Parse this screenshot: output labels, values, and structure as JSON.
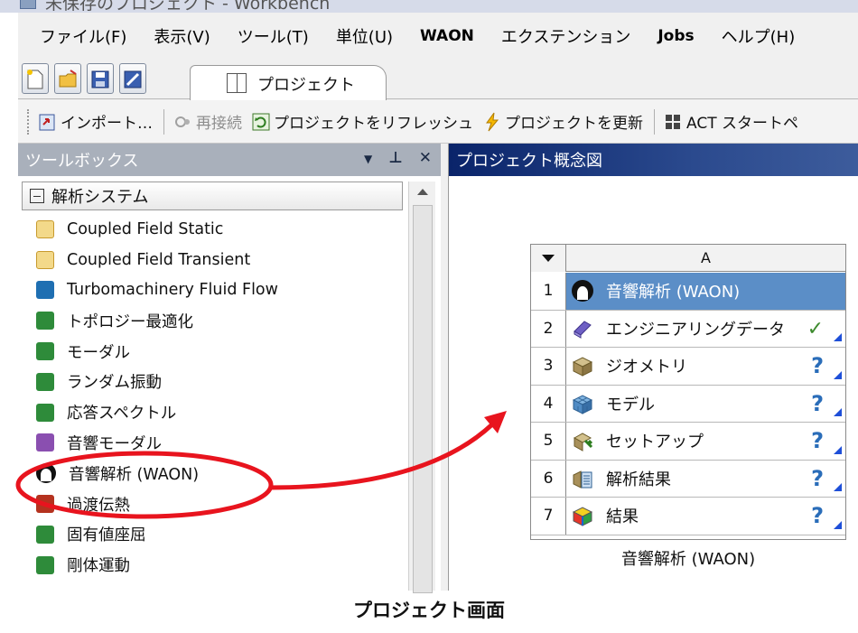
{
  "window": {
    "title": "未保存のプロジェクト - Workbench"
  },
  "menu": [
    "ファイル(F)",
    "表示(V)",
    "ツール(T)",
    "単位(U)",
    "WAON",
    "エクステンション",
    "Jobs",
    "ヘルプ(H)"
  ],
  "tab": {
    "label": "プロジェクト"
  },
  "toolbar": {
    "import": "インポート…",
    "reconnect": "再接続",
    "refresh": "プロジェクトをリフレッシュ",
    "update": "プロジェクトを更新",
    "act": "ACT スタートペ"
  },
  "toolbox": {
    "title": "ツールボックス",
    "category": "解析システム",
    "items": [
      {
        "label": "Coupled Field Static",
        "icon": "coupled-field-static-icon",
        "color": "#c79a2d"
      },
      {
        "label": "Coupled Field Transient",
        "icon": "coupled-field-transient-icon",
        "color": "#c79a2d"
      },
      {
        "label": "Turbomachinery Fluid Flow",
        "icon": "turbomachinery-icon",
        "color": "#1f6fb2"
      },
      {
        "label": "トポロジー最適化",
        "icon": "topology-icon",
        "color": "#2e8b3a"
      },
      {
        "label": "モーダル",
        "icon": "modal-icon",
        "color": "#2e8b3a"
      },
      {
        "label": "ランダム振動",
        "icon": "random-vibration-icon",
        "color": "#2e8b3a"
      },
      {
        "label": "応答スペクトル",
        "icon": "response-spectrum-icon",
        "color": "#2e8b3a"
      },
      {
        "label": "音響モーダル",
        "icon": "acoustic-modal-icon",
        "color": "#8a4fb0"
      },
      {
        "label": "音響解析 (WAON)",
        "icon": "waon-icon",
        "color": "#111111"
      },
      {
        "label": "過渡伝熱",
        "icon": "transient-thermal-icon",
        "color": "#b5321f"
      },
      {
        "label": "固有値座屈",
        "icon": "eigenvalue-buckling-icon",
        "color": "#2e8b3a"
      },
      {
        "label": "剛体運動",
        "icon": "rigid-dynamics-icon",
        "color": "#2e8b3a"
      }
    ]
  },
  "schematic": {
    "title": "プロジェクト概念図",
    "column": "A",
    "rows": [
      {
        "num": "1",
        "label": "音響解析 (WAON)",
        "icon": "waon-icon",
        "status": "",
        "selected": true
      },
      {
        "num": "2",
        "label": "エンジニアリングデータ",
        "icon": "engineering-data-icon",
        "status": "✓"
      },
      {
        "num": "3",
        "label": "ジオメトリ",
        "icon": "geometry-icon",
        "status": "?"
      },
      {
        "num": "4",
        "label": "モデル",
        "icon": "model-icon",
        "status": "?"
      },
      {
        "num": "5",
        "label": "セットアップ",
        "icon": "setup-icon",
        "status": "?"
      },
      {
        "num": "6",
        "label": "解析結果",
        "icon": "solution-icon",
        "status": "?"
      },
      {
        "num": "7",
        "label": "結果",
        "icon": "results-icon",
        "status": "?"
      }
    ],
    "caption": "音響解析 (WAON)"
  },
  "figure_caption": "プロジェクト画面",
  "colors": {
    "annotation": "#e8141e",
    "selection": "#5b8ec7",
    "schematic_header": "#0a246a"
  }
}
